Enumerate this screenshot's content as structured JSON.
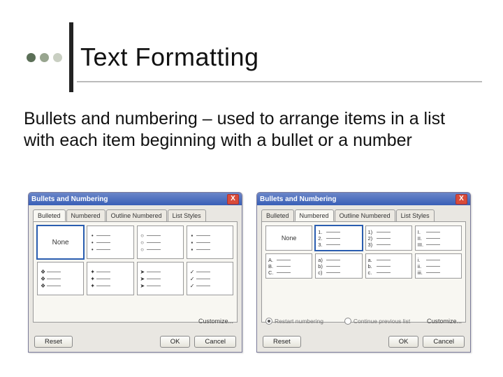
{
  "title": "Text Formatting",
  "body": "Bullets and numbering – used to arrange items in a list with each item beginning with a bullet or a number",
  "dots": [
    "#5b6f57",
    "#98a58f",
    "#c9cfc2"
  ],
  "dialog": {
    "title": "Bullets and Numbering",
    "close": "X",
    "customize": "Customize...",
    "reset": "Reset",
    "ok": "OK",
    "cancel": "Cancel",
    "tabs": {
      "bulleted": "Bulleted",
      "numbered": "Numbered",
      "outline": "Outline Numbered",
      "liststyles": "List Styles"
    },
    "none": "None",
    "radios": {
      "restart": "Restart numbering",
      "continue": "Continue previous list"
    }
  },
  "bulleted": {
    "cells": [
      {
        "type": "none"
      },
      {
        "marks": [
          "•",
          "•",
          "•"
        ]
      },
      {
        "marks": [
          "○",
          "○",
          "○"
        ]
      },
      {
        "marks": [
          "▪",
          "▪",
          "▪"
        ]
      },
      {
        "marks": [
          "❖",
          "❖",
          "❖"
        ]
      },
      {
        "marks": [
          "✦",
          "✦",
          "✦"
        ]
      },
      {
        "marks": [
          "➤",
          "➤",
          "➤"
        ]
      },
      {
        "marks": [
          "✓",
          "✓",
          "✓"
        ]
      }
    ]
  },
  "numbered": {
    "cells": [
      {
        "type": "none"
      },
      {
        "marks": [
          "1.",
          "2.",
          "3."
        ]
      },
      {
        "marks": [
          "1)",
          "2)",
          "3)"
        ]
      },
      {
        "marks": [
          "I.",
          "II.",
          "III."
        ]
      },
      {
        "marks": [
          "A.",
          "B.",
          "C."
        ]
      },
      {
        "marks": [
          "a)",
          "b)",
          "c)"
        ]
      },
      {
        "marks": [
          "a.",
          "b.",
          "c."
        ]
      },
      {
        "marks": [
          "i.",
          "ii.",
          "iii."
        ]
      }
    ]
  }
}
